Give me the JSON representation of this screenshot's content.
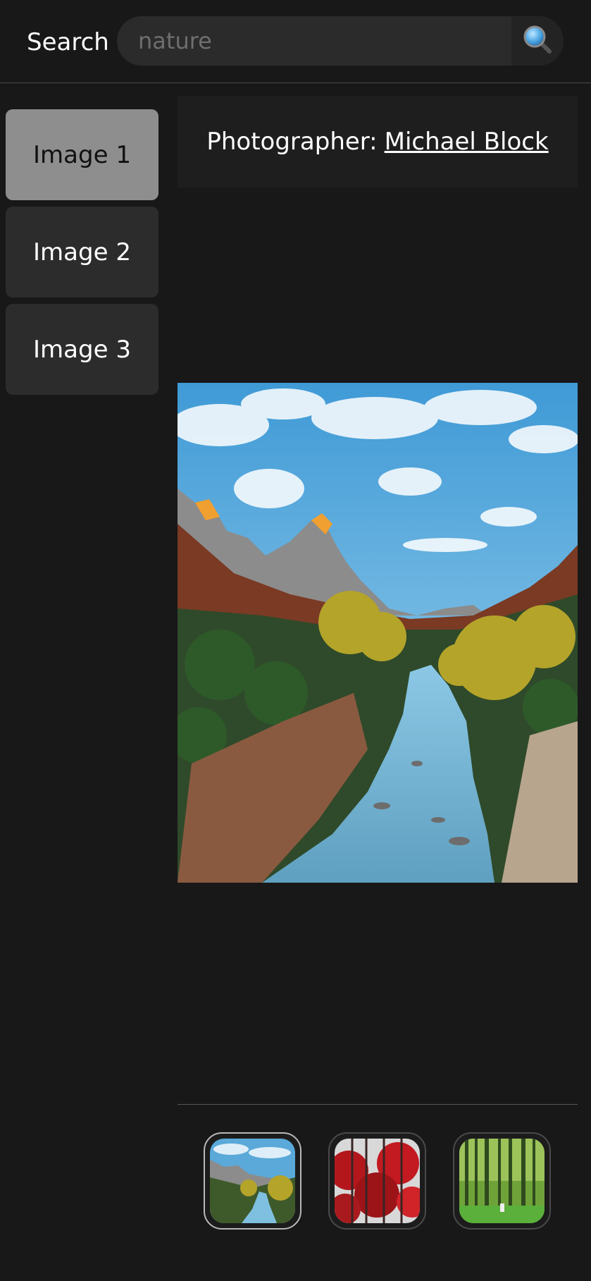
{
  "header": {
    "search_label": "Search",
    "search_placeholder": "nature",
    "search_icon": "magnifier-icon"
  },
  "sidebar": {
    "items": [
      {
        "label": "Image 1",
        "active": true
      },
      {
        "label": "Image 2",
        "active": false
      },
      {
        "label": "Image 3",
        "active": false
      }
    ]
  },
  "credit": {
    "prefix": "Photographer:",
    "name": "Michael Block"
  },
  "colors": {
    "background": "#181818",
    "active_item": "#8e8e8e",
    "item": "#2c2c2c",
    "sky": "#4aa3d9",
    "river": "#5aa9d4",
    "foliage": "#c9b02a"
  },
  "thumbnails": [
    {
      "subject": "river-canyon",
      "active": true
    },
    {
      "subject": "red-forest",
      "active": false
    },
    {
      "subject": "green-forest",
      "active": false
    }
  ]
}
